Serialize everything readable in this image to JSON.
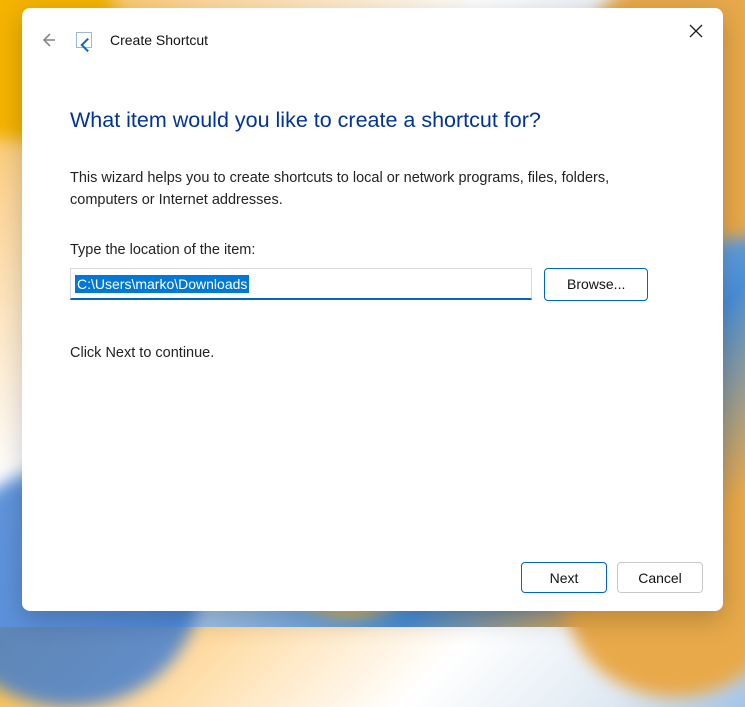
{
  "window": {
    "title": "Create Shortcut"
  },
  "content": {
    "heading": "What item would you like to create a shortcut for?",
    "description": "This wizard helps you to create shortcuts to local or network programs, files, folders, computers or Internet addresses.",
    "field_label": "Type the location of the item:",
    "location_value": "C:\\Users\\marko\\Downloads",
    "browse_label": "Browse...",
    "continue_text": "Click Next to continue."
  },
  "footer": {
    "next_label": "Next",
    "cancel_label": "Cancel"
  }
}
